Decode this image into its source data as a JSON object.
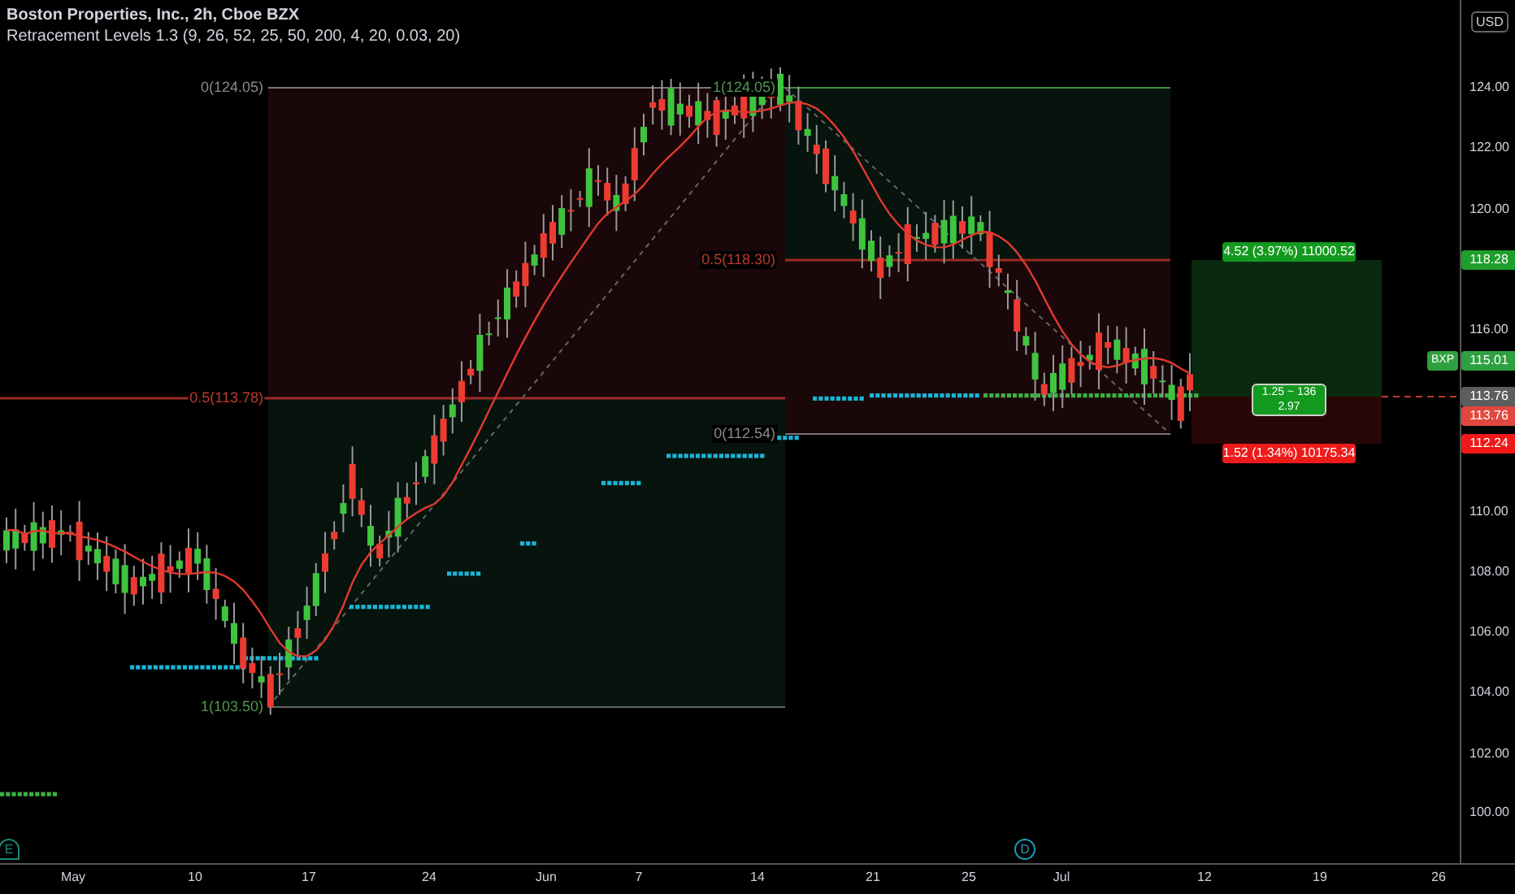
{
  "header": {
    "title": "Boston Properties, Inc., 2h, Cboe BZX",
    "indicator": "Retracement Levels 1.3 (9, 26, 52, 25, 50, 200, 4, 20, 0.03, 20)"
  },
  "currency": "USD",
  "price_axis": [
    "124.00",
    "122.00",
    "120.00",
    "116.00",
    "110.00",
    "108.00",
    "106.00",
    "104.00",
    "102.00",
    "100.00"
  ],
  "price_tags": [
    {
      "label": "118.28",
      "color": "#1e9e2c"
    },
    {
      "label": "115.01",
      "color": "#2fa040",
      "symbol": "BXP"
    },
    {
      "label": "113.76",
      "color": "#5d5d5d"
    },
    {
      "label": "113.76",
      "color": "#e0483f"
    },
    {
      "label": "112.24",
      "color": "#f01818"
    }
  ],
  "fib_levels": [
    {
      "label": "0(124.05)",
      "color": "#8a8a8a"
    },
    {
      "label": "1(124.05)",
      "color": "#4f9a4f"
    },
    {
      "label": "0.5(118.30)",
      "color": "#c0392b"
    },
    {
      "label": "0.5(113.78)",
      "color": "#c0392b"
    },
    {
      "label": "0(112.54)",
      "color": "#8a8a8a"
    },
    {
      "label": "1(103.50)",
      "color": "#4f9a4f"
    }
  ],
  "position": {
    "target": "4.52 (3.97%) 11000.52",
    "ratio": [
      "1.25 ~ 136",
      "2.97"
    ],
    "stop": "1.52 (1.34%) 10175.34"
  },
  "events": [
    {
      "kind": "earnings",
      "label": "E"
    },
    {
      "kind": "dividend",
      "label": "D"
    }
  ],
  "time_axis": [
    "May",
    "10",
    "17",
    "24",
    "Jun",
    "7",
    "14",
    "21",
    "25",
    "Jul",
    "12",
    "19",
    "26"
  ]
}
